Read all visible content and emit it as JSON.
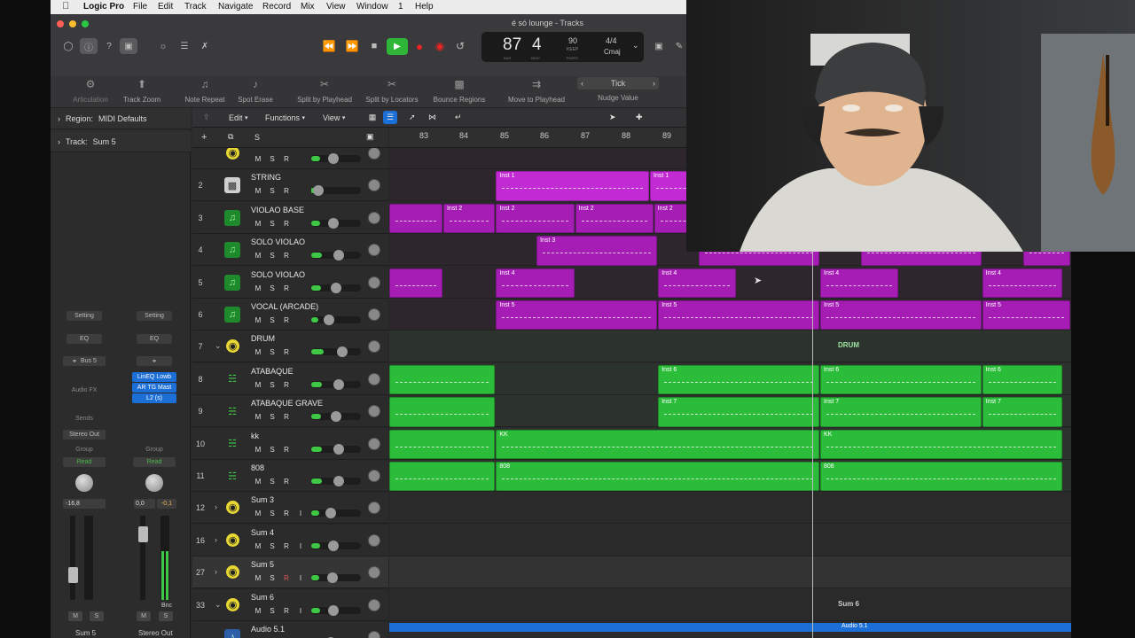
{
  "menubar": {
    "app": "Logic Pro",
    "items": [
      "File",
      "Edit",
      "Track",
      "Navigate",
      "Record",
      "Mix",
      "View",
      "Window",
      "1",
      "Help"
    ]
  },
  "window": {
    "title": "é só lounge - Tracks"
  },
  "lcd": {
    "bar": "87",
    "beat": "4",
    "tempo": "90",
    "tempo_label": "KEEP",
    "signature": "4/4",
    "key": "Cmaj",
    "captions": [
      "BAR",
      "BEAT",
      "TEMPO"
    ]
  },
  "toolbar": {
    "tools": [
      "Articulation",
      "Track Zoom",
      "Note Repeat",
      "Spot Erase",
      "Split by Playhead",
      "Split by Locators",
      "Bounce Regions",
      "Move to Playhead",
      "Nudge Value"
    ],
    "nudge_value": "Tick"
  },
  "inspector": {
    "region_label": "Region:",
    "region_value": "MIDI Defaults",
    "track_label": "Track:",
    "track_value": "Sum 5",
    "strip1": {
      "setting": "Setting",
      "eq": "EQ",
      "bus": "Bus 5",
      "audio_fx": "Audio FX",
      "sends": "Sends",
      "output": "Stereo Out",
      "group": "Group",
      "automation": "Read",
      "volume": "-16,8",
      "name": "Sum 5"
    },
    "strip2": {
      "setting": "Setting",
      "eq": "EQ",
      "plugins": [
        "LinEQ Lowb",
        "AR TG Mast",
        "L2 (s)"
      ],
      "group": "Group",
      "automation": "Read",
      "volume": "0,0",
      "peak": "-0,1",
      "bounce": "Bnc",
      "name": "Stereo Out"
    },
    "mute": "M",
    "solo": "S"
  },
  "editbar": {
    "edit": "Edit",
    "functions": "Functions",
    "view": "View"
  },
  "ruler": {
    "bars": [
      "83",
      "84",
      "85",
      "86",
      "87",
      "88",
      "89"
    ]
  },
  "track_header_btn": {
    "m": "M",
    "s": "S",
    "r": "R",
    "i": "I"
  },
  "tracks": [
    {
      "num": "",
      "name": "",
      "type": "folder",
      "level": 0.45
    },
    {
      "num": "2",
      "name": "STRING",
      "type": "synth",
      "level": 0.15
    },
    {
      "num": "3",
      "name": "VIOLAO BASE",
      "type": "midi",
      "level": 0.45
    },
    {
      "num": "4",
      "name": "SOLO VIOLAO",
      "type": "midi",
      "level": 0.55
    },
    {
      "num": "5",
      "name": "SOLO VIOLAO",
      "type": "midi",
      "level": 0.5
    },
    {
      "num": "6",
      "name": "VOCAL (ARCADE)",
      "type": "midi",
      "level": 0.35
    },
    {
      "num": "7",
      "name": "DRUM",
      "type": "folder",
      "level": 0.62
    },
    {
      "num": "8",
      "name": "ATABAQUE",
      "type": "drum",
      "level": 0.55
    },
    {
      "num": "9",
      "name": "ATABAQUE GRAVE",
      "type": "drum",
      "level": 0.5
    },
    {
      "num": "10",
      "name": "kk",
      "type": "drum",
      "level": 0.55
    },
    {
      "num": "11",
      "name": "808",
      "type": "drum",
      "level": 0.55
    },
    {
      "num": "12",
      "name": "Sum 3",
      "type": "folder",
      "level": 0.4
    },
    {
      "num": "16",
      "name": "Sum 4",
      "type": "folder",
      "level": 0.45
    },
    {
      "num": "27",
      "name": "Sum 5",
      "type": "folder",
      "level": 0.42,
      "selected": true
    },
    {
      "num": "33",
      "name": "Sum 6",
      "type": "folder",
      "level": 0.45
    },
    {
      "num": "",
      "name": "Audio 5.1",
      "type": "audio",
      "level": 0.4
    }
  ],
  "regions": {
    "purple": [
      {
        "lane": 1,
        "label": "Inst 1"
      },
      {
        "lane": 1,
        "label": "Inst 1"
      },
      {
        "lane": 2,
        "label": ""
      },
      {
        "lane": 2,
        "label": "Inst 2"
      },
      {
        "lane": 2,
        "label": "Inst 2"
      },
      {
        "lane": 2,
        "label": "Inst 2"
      },
      {
        "lane": 2,
        "label": "Inst 2"
      },
      {
        "lane": 3,
        "label": "Inst 3"
      },
      {
        "lane": 3,
        "label": ""
      },
      {
        "lane": 3,
        "label": ""
      },
      {
        "lane": 3,
        "label": ""
      },
      {
        "lane": 4,
        "label": ""
      },
      {
        "lane": 4,
        "label": "Inst 4"
      },
      {
        "lane": 4,
        "label": "Inst 4"
      },
      {
        "lane": 4,
        "label": "Inst 4"
      },
      {
        "lane": 4,
        "label": "Inst 4"
      },
      {
        "lane": 5,
        "label": "Inst 5"
      },
      {
        "lane": 5,
        "label": "Inst 5"
      },
      {
        "lane": 5,
        "label": "Inst 5"
      },
      {
        "lane": 5,
        "label": "Inst 5"
      }
    ],
    "green": [
      {
        "lane": 7,
        "label": ""
      },
      {
        "lane": 7,
        "label": "Inst 6"
      },
      {
        "lane": 7,
        "label": "Inst 6"
      },
      {
        "lane": 7,
        "label": "Inst 6"
      },
      {
        "lane": 8,
        "label": ""
      },
      {
        "lane": 8,
        "label": "Inst 7"
      },
      {
        "lane": 8,
        "label": "Inst 7"
      },
      {
        "lane": 8,
        "label": "Inst 7"
      },
      {
        "lane": 9,
        "label": ""
      },
      {
        "lane": 9,
        "label": "KK"
      },
      {
        "lane": 9,
        "label": "KK"
      },
      {
        "lane": 10,
        "label": ""
      },
      {
        "lane": 10,
        "label": "808"
      },
      {
        "lane": 10,
        "label": "808"
      }
    ],
    "drum_folder_label": "DRUM",
    "sum6_label": "Sum 6",
    "audio_label": "Audio 5.1"
  },
  "colors": {
    "purple_region": "#a61db5",
    "purple_region_light": "#c22ad3",
    "green_region": "#2bbd3a",
    "accent_blue": "#1d6fd8"
  }
}
